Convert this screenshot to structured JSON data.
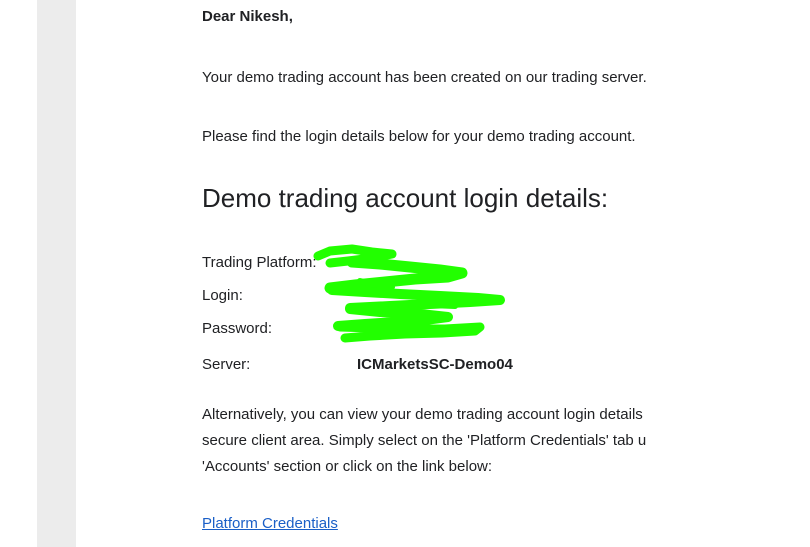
{
  "email": {
    "greeting": "Dear Nikesh,",
    "para1": "Your demo trading account has been created on our trading server.",
    "para2": "Please find the login details below for your demo trading account.",
    "heading": "Demo trading account login details:",
    "details": {
      "platform_label": "Trading Platform:",
      "login_label": "Login:",
      "password_label": "Password:",
      "server_label": "Server:",
      "server_value": "ICMarketsSC-Demo04"
    },
    "alt_line1": "Alternatively, you can view your demo trading account login details",
    "alt_line2": "secure client area. Simply select on the 'Platform Credentials' tab u",
    "alt_line3": "'Accounts' section or click on the link below:",
    "link_label": "Platform Credentials"
  },
  "colors": {
    "redaction": "#22ff00",
    "link": "#1a5fc7",
    "side_panel": "#ececec"
  }
}
